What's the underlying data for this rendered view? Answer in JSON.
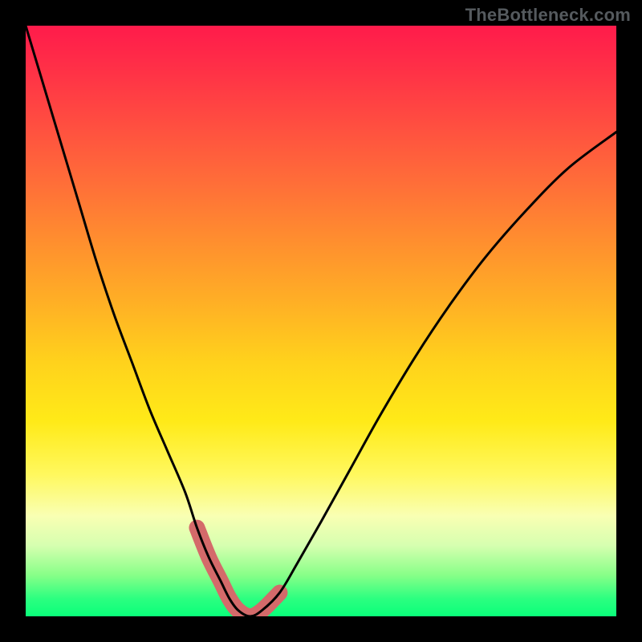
{
  "watermark": "TheBottleneck.com",
  "chart_data": {
    "type": "line",
    "title": "",
    "xlabel": "",
    "ylabel": "",
    "xlim": [
      0,
      100
    ],
    "ylim": [
      0,
      100
    ],
    "series": [
      {
        "name": "bottleneck-curve",
        "x": [
          0,
          3,
          6,
          9,
          12,
          15,
          18,
          21,
          24,
          27,
          29,
          31,
          33,
          34.5,
          36,
          38,
          40,
          43,
          46,
          50,
          55,
          60,
          66,
          72,
          78,
          85,
          92,
          100
        ],
        "values": [
          100,
          90,
          80,
          70,
          60,
          51,
          43,
          35,
          28,
          21,
          15,
          10,
          6,
          3,
          1,
          0,
          1,
          4,
          9,
          16,
          25,
          34,
          44,
          53,
          61,
          69,
          76,
          82
        ]
      }
    ],
    "highlight_band": {
      "name": "optimal-zone",
      "x": [
        29,
        31,
        33,
        34.5,
        36,
        38,
        40,
        43
      ],
      "values": [
        15,
        10,
        6,
        3,
        1,
        0,
        1,
        4
      ]
    },
    "colors": {
      "curve": "#000000",
      "highlight": "#d46a6a",
      "gradient_top": "#ff1b4b",
      "gradient_mid": "#ffd21c",
      "gradient_bottom": "#0aff7a",
      "frame": "#000000"
    }
  }
}
